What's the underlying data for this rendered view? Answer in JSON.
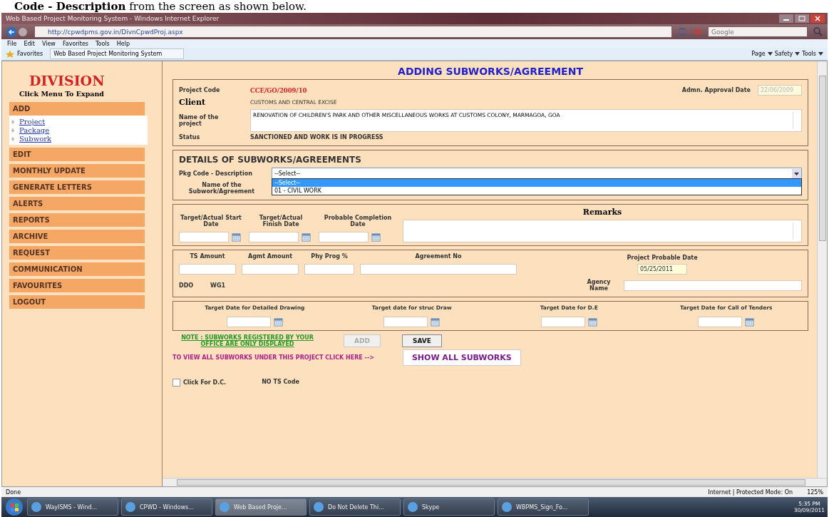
{
  "document_caption": "**Code - Description** from the screen as shown below.",
  "browser": {
    "title": "Web Based Project Monitoring System - Windows Internet Explorer",
    "address": "http://cpwdpms.gov.in/DivnCpwdProj.aspx",
    "search_placeholder": "Google",
    "menu": [
      "File",
      "Edit",
      "View",
      "Favorites",
      "Tools",
      "Help"
    ],
    "favorites_label": "Favorites",
    "favorite_tab": "Web Based Project Monitoring System",
    "commands": [
      "Page",
      "Safety",
      "Tools"
    ]
  },
  "sidebar": {
    "title": "DIVISION",
    "hint": "Click Menu To Expand",
    "menus": [
      {
        "label": "ADD",
        "children": [
          {
            "label": "Project"
          },
          {
            "label": "Package"
          },
          {
            "label": "Subwork"
          }
        ]
      },
      {
        "label": "EDIT"
      },
      {
        "label": "MONTHLY UPDATE"
      },
      {
        "label": "GENERATE LETTERS"
      },
      {
        "label": "ALERTS"
      },
      {
        "label": "REPORTS"
      },
      {
        "label": "ARCHIVE"
      },
      {
        "label": "REQUEST"
      },
      {
        "label": "COMMUNICATION"
      },
      {
        "label": "FAVOURITES"
      },
      {
        "label": "LOGOUT"
      }
    ]
  },
  "page_title": "ADDING SUBWORKS/AGREEMENT",
  "project": {
    "code_label": "Project Code",
    "code": "CCE/GO/2009/10",
    "approval_label": "Admn. Approval Date",
    "approval_value": "22/06/2009",
    "client_label": "Client",
    "client": "CUSTOMS AND CENTRAL EXCISE",
    "name_label": "Name of the project",
    "name": "RENOVATION OF CHILDREN'S PARK AND OTHER MISCELLANEOUS WORKS AT CUSTOMS COLONY, MARMAGOA, GOA",
    "status_label": "Status",
    "status": "SANCTIONED AND WORK IS IN PROGRESS"
  },
  "details": {
    "heading": "DETAILS OF SUBWORKS/AGREEMENTS",
    "pkg_label": "Pkg Code - Description",
    "pkg_value": "--Select--",
    "options": [
      {
        "label": "--Select--",
        "selected": true
      },
      {
        "label": "01 - CIVIL WORK",
        "selected": false
      }
    ],
    "name_label": "Name of the Subwork/Agreement"
  },
  "dates": {
    "fields": [
      {
        "label": "Target/Actual Start Date"
      },
      {
        "label": "Target/Actual Finish Date"
      },
      {
        "label": "Probable Completion Date"
      }
    ],
    "remarks_label": "Remarks"
  },
  "amounts": {
    "fields": [
      {
        "label": "TS Amount"
      },
      {
        "label": "Agmt Amount"
      },
      {
        "label": "Phy Prog %"
      },
      {
        "label": "Agreement No"
      }
    ],
    "probable_label": "Project Probable Date",
    "probable_value": "05/25/2011",
    "ddo_label": "DDO",
    "ddo_value": "WG1",
    "agency_label": "Agency Name"
  },
  "targets": [
    {
      "label": "Target Date for Detailed Drawing"
    },
    {
      "label": "Target date for struc Draw"
    },
    {
      "label": "Target Date for D.E"
    },
    {
      "label": "Target Date for Call of Tenders"
    }
  ],
  "note": "NOTE : SUBWORKS REGISTERED BY YOUR OFFICE ARE ONLY DISPLAYED",
  "buttons": [
    {
      "label": "ADD",
      "disabled": true
    },
    {
      "label": "SAVE",
      "disabled": false
    }
  ],
  "view_all_text": "TO VIEW ALL SUBWORKS UNDER THIS PROJECT CLICK HERE -->",
  "show_all_button": "SHOW ALL SUBWORKS",
  "dc_checkbox": {
    "label": "Click For D.C.",
    "checked": false
  },
  "no_ts_code": "NO TS Code",
  "status_bar": {
    "text": "Done",
    "zone": "Internet | Protected Mode: On",
    "zoom": "125%"
  },
  "taskbar": {
    "items": [
      {
        "label": "WayISMS - Wind...",
        "selected": false
      },
      {
        "label": "CPWD - Windows...",
        "selected": false
      },
      {
        "label": "Web Based Proje...",
        "selected": true
      },
      {
        "label": "Do Not Delete Thi...",
        "selected": false
      },
      {
        "label": "Skype",
        "selected": false
      },
      {
        "label": "WBPMS_Sign_Fo...",
        "selected": false
      }
    ],
    "time": "5:35 PM",
    "date": "30/09/2011"
  }
}
